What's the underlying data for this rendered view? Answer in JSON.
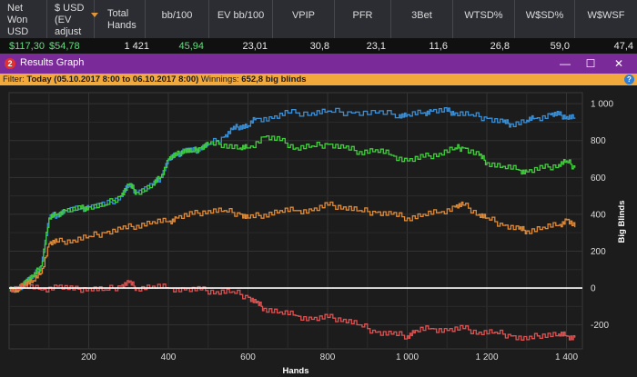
{
  "stats": {
    "columns": [
      {
        "header": [
          "Net",
          "Won",
          "USD"
        ],
        "value": "$117,30",
        "value_color": "green"
      },
      {
        "header": [
          "$ USD",
          "(EV",
          "adjust"
        ],
        "value": "$54,78",
        "value_color": "green",
        "sorted": true
      },
      {
        "header": [
          "Total",
          "Hands"
        ],
        "value": "1 421",
        "value_color": "white"
      },
      {
        "header": [
          "bb/100"
        ],
        "value": "45,94",
        "value_color": "green"
      },
      {
        "header": [
          "EV bb/100"
        ],
        "value": "23,01",
        "value_color": "white"
      },
      {
        "header": [
          "VPIP"
        ],
        "value": "30,8",
        "value_color": "white"
      },
      {
        "header": [
          "PFR"
        ],
        "value": "23,1",
        "value_color": "white"
      },
      {
        "header": [
          "3Bet"
        ],
        "value": "11,6",
        "value_color": "white"
      },
      {
        "header": [
          "WTSD%"
        ],
        "value": "26,8",
        "value_color": "white"
      },
      {
        "header": [
          "W$SD%"
        ],
        "value": "59,0",
        "value_color": "white"
      },
      {
        "header": [
          "W$WSF"
        ],
        "value": "47,4",
        "value_color": "white"
      }
    ]
  },
  "window": {
    "icon_label": "2",
    "title": "Results Graph",
    "minimize": "—",
    "maximize": "☐",
    "close": "✕"
  },
  "filter": {
    "label": "Filter:",
    "range": "Today (05.10.2017 8:00 to 06.10.2017 8:00)",
    "winnings_label": "Winnings:",
    "winnings_value": "652,8 big blinds",
    "help": "?"
  },
  "chart_data": {
    "type": "line",
    "xlabel": "Hands",
    "ylabel": "Big Blinds",
    "xlim": [
      0,
      1440
    ],
    "ylim": [
      -330,
      1060
    ],
    "x_ticks": [
      200,
      400,
      600,
      800,
      1000,
      1200,
      1400
    ],
    "x_tick_labels": [
      "200",
      "400",
      "600",
      "800",
      "1 000",
      "1 200",
      "1 400"
    ],
    "y_ticks": [
      1000,
      800,
      600,
      400,
      200,
      0,
      -200
    ],
    "y_tick_labels": [
      "1 000",
      "800",
      "600",
      "400",
      "200",
      "0",
      "-200"
    ],
    "grid": true,
    "series": [
      {
        "color": "#3a8fd6",
        "points": [
          [
            0,
            0
          ],
          [
            20,
            -20
          ],
          [
            40,
            40
          ],
          [
            60,
            60
          ],
          [
            80,
            120
          ],
          [
            100,
            380
          ],
          [
            120,
            400
          ],
          [
            140,
            420
          ],
          [
            180,
            430
          ],
          [
            200,
            440
          ],
          [
            240,
            450
          ],
          [
            280,
            500
          ],
          [
            300,
            560
          ],
          [
            320,
            520
          ],
          [
            360,
            560
          ],
          [
            380,
            600
          ],
          [
            400,
            700
          ],
          [
            420,
            720
          ],
          [
            440,
            750
          ],
          [
            460,
            740
          ],
          [
            480,
            760
          ],
          [
            500,
            780
          ],
          [
            540,
            820
          ],
          [
            560,
            860
          ],
          [
            580,
            880
          ],
          [
            600,
            880
          ],
          [
            620,
            920
          ],
          [
            660,
            920
          ],
          [
            700,
            950
          ],
          [
            760,
            950
          ],
          [
            800,
            960
          ],
          [
            860,
            950
          ],
          [
            920,
            950
          ],
          [
            980,
            940
          ],
          [
            1000,
            940
          ],
          [
            1040,
            950
          ],
          [
            1060,
            960
          ],
          [
            1100,
            960
          ],
          [
            1120,
            950
          ],
          [
            1160,
            940
          ],
          [
            1200,
            920
          ],
          [
            1240,
            900
          ],
          [
            1260,
            890
          ],
          [
            1300,
            910
          ],
          [
            1320,
            920
          ],
          [
            1360,
            940
          ],
          [
            1380,
            940
          ],
          [
            1400,
            930
          ],
          [
            1421,
            925
          ]
        ]
      },
      {
        "color": "#3fcf3a",
        "points": [
          [
            0,
            0
          ],
          [
            20,
            -20
          ],
          [
            40,
            40
          ],
          [
            60,
            60
          ],
          [
            80,
            120
          ],
          [
            100,
            380
          ],
          [
            120,
            400
          ],
          [
            140,
            420
          ],
          [
            180,
            430
          ],
          [
            200,
            440
          ],
          [
            240,
            450
          ],
          [
            280,
            500
          ],
          [
            300,
            560
          ],
          [
            320,
            520
          ],
          [
            360,
            560
          ],
          [
            380,
            600
          ],
          [
            400,
            700
          ],
          [
            420,
            720
          ],
          [
            440,
            750
          ],
          [
            460,
            740
          ],
          [
            480,
            760
          ],
          [
            500,
            780
          ],
          [
            540,
            780
          ],
          [
            580,
            760
          ],
          [
            600,
            760
          ],
          [
            640,
            820
          ],
          [
            680,
            800
          ],
          [
            720,
            760
          ],
          [
            760,
            770
          ],
          [
            800,
            780
          ],
          [
            840,
            760
          ],
          [
            880,
            740
          ],
          [
            920,
            750
          ],
          [
            960,
            720
          ],
          [
            1000,
            690
          ],
          [
            1040,
            710
          ],
          [
            1080,
            730
          ],
          [
            1120,
            760
          ],
          [
            1140,
            760
          ],
          [
            1180,
            720
          ],
          [
            1200,
            680
          ],
          [
            1240,
            660
          ],
          [
            1280,
            640
          ],
          [
            1300,
            630
          ],
          [
            1340,
            650
          ],
          [
            1380,
            670
          ],
          [
            1400,
            690
          ],
          [
            1421,
            652
          ]
        ]
      },
      {
        "color": "#e08a35",
        "points": [
          [
            0,
            0
          ],
          [
            20,
            -20
          ],
          [
            40,
            30
          ],
          [
            60,
            40
          ],
          [
            80,
            80
          ],
          [
            100,
            240
          ],
          [
            120,
            250
          ],
          [
            160,
            260
          ],
          [
            200,
            280
          ],
          [
            240,
            300
          ],
          [
            280,
            320
          ],
          [
            320,
            340
          ],
          [
            360,
            360
          ],
          [
            400,
            360
          ],
          [
            420,
            380
          ],
          [
            460,
            400
          ],
          [
            500,
            420
          ],
          [
            540,
            420
          ],
          [
            580,
            400
          ],
          [
            600,
            380
          ],
          [
            640,
            400
          ],
          [
            680,
            420
          ],
          [
            720,
            420
          ],
          [
            760,
            420
          ],
          [
            800,
            450
          ],
          [
            840,
            440
          ],
          [
            880,
            420
          ],
          [
            920,
            410
          ],
          [
            960,
            400
          ],
          [
            1000,
            380
          ],
          [
            1040,
            400
          ],
          [
            1080,
            410
          ],
          [
            1120,
            440
          ],
          [
            1140,
            450
          ],
          [
            1180,
            400
          ],
          [
            1200,
            380
          ],
          [
            1240,
            340
          ],
          [
            1280,
            320
          ],
          [
            1300,
            310
          ],
          [
            1340,
            330
          ],
          [
            1380,
            340
          ],
          [
            1400,
            370
          ],
          [
            1421,
            330
          ]
        ]
      },
      {
        "color": "#e05050",
        "points": [
          [
            0,
            0
          ],
          [
            40,
            10
          ],
          [
            80,
            -10
          ],
          [
            120,
            10
          ],
          [
            160,
            -10
          ],
          [
            200,
            0
          ],
          [
            240,
            -10
          ],
          [
            280,
            10
          ],
          [
            300,
            30
          ],
          [
            320,
            0
          ],
          [
            360,
            10
          ],
          [
            400,
            0
          ],
          [
            440,
            -10
          ],
          [
            480,
            -10
          ],
          [
            520,
            -20
          ],
          [
            560,
            -20
          ],
          [
            600,
            -50
          ],
          [
            620,
            -80
          ],
          [
            640,
            -110
          ],
          [
            680,
            -130
          ],
          [
            720,
            -150
          ],
          [
            760,
            -170
          ],
          [
            800,
            -160
          ],
          [
            840,
            -170
          ],
          [
            880,
            -200
          ],
          [
            920,
            -240
          ],
          [
            960,
            -250
          ],
          [
            1000,
            -260
          ],
          [
            1020,
            -230
          ],
          [
            1060,
            -220
          ],
          [
            1100,
            -230
          ],
          [
            1140,
            -220
          ],
          [
            1180,
            -240
          ],
          [
            1220,
            -240
          ],
          [
            1260,
            -260
          ],
          [
            1300,
            -280
          ],
          [
            1340,
            -250
          ],
          [
            1380,
            -250
          ],
          [
            1400,
            -260
          ],
          [
            1421,
            -270
          ]
        ]
      }
    ]
  }
}
